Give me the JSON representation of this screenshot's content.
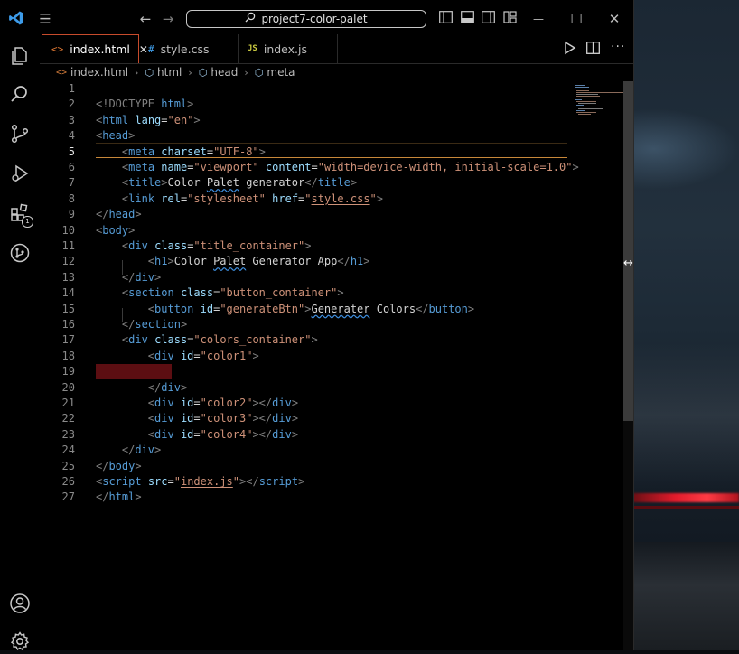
{
  "window": {
    "search_title": "project7-color-palet"
  },
  "tabs": [
    {
      "icon": "<>",
      "label": "index.html",
      "close": "✕"
    },
    {
      "icon": "#",
      "label": "style.css"
    },
    {
      "icon": "JS",
      "label": "index.js"
    }
  ],
  "breadcrumbs": [
    "index.html",
    "html",
    "head",
    "meta"
  ],
  "editor": {
    "current_line": 5,
    "line_numbers": [
      "1",
      "2",
      "3",
      "4",
      "5",
      "6",
      "7",
      "8",
      "9",
      "10",
      "11",
      "12",
      "13",
      "14",
      "15",
      "16",
      "17",
      "18",
      "19",
      "20",
      "21",
      "22",
      "23",
      "24",
      "25",
      "26",
      "27"
    ]
  },
  "code": {
    "l2_doctype": "DOCTYPE",
    "l2_html": "html",
    "l3_tag": "html",
    "l3_attr": "lang",
    "l3_val": "\"en\"",
    "l4_tag": "head",
    "l5_tag": "meta",
    "l5_attr": "charset",
    "l5_val": "\"UTF-8\"",
    "l6_tag": "meta",
    "l6_attr1": "name",
    "l6_val1": "\"viewport\"",
    "l6_attr2": "content",
    "l6_val2": "\"width=device-width, initial-scale=1.0\"",
    "l7_tag": "title",
    "l7_text_a": "Color ",
    "l7_text_b": "Palet",
    "l7_text_c": " generator",
    "l8_tag": "link",
    "l8_attr1": "rel",
    "l8_val1": "\"stylesheet\"",
    "l8_attr2": "href",
    "l8_val2a": "\"",
    "l8_val2b": "style.css",
    "l8_val2c": "\"",
    "l9_tag": "head",
    "l10_tag": "body",
    "l11_tag": "div",
    "l11_attr": "class",
    "l11_val": "\"title_container\"",
    "l12_tag": "h1",
    "l12_text_a": "Color ",
    "l12_text_b": "Palet",
    "l12_text_c": " Generator App",
    "l13_tag": "div",
    "l14_tag": "section",
    "l14_attr": "class",
    "l14_val": "\"button_container\"",
    "l15_tag": "button",
    "l15_attr": "id",
    "l15_val": "\"generateBtn\"",
    "l15_text_a": "Generater",
    "l15_text_b": " Colors",
    "l16_tag": "section",
    "l17_tag": "div",
    "l17_attr": "class",
    "l17_val": "\"colors_container\"",
    "l18_tag": "div",
    "l18_attr": "id",
    "l18_val": "\"color1\"",
    "l20_tag": "div",
    "l21_tag": "div",
    "l21_attr": "id",
    "l21_val": "\"color2\"",
    "l22_tag": "div",
    "l22_attr": "id",
    "l22_val": "\"color3\"",
    "l23_tag": "div",
    "l23_attr": "id",
    "l23_val": "\"color4\"",
    "l24_tag": "div",
    "l25_tag": "body",
    "l26_tag": "script",
    "l26_attr": "src",
    "l26_val_a": "\"",
    "l26_val_b": "index.js",
    "l26_val_c": "\"",
    "l27_tag": "html"
  },
  "icons": {
    "menu": "☰",
    "back": "←",
    "forward": "→",
    "search": "⌕",
    "minimize": "—",
    "maximize": "☐",
    "close": "✕",
    "more": "···"
  },
  "activity": {
    "extensions_badge": "1"
  },
  "colors": {
    "accent_tab": "#c74b2c",
    "error_block": "#5c0e12",
    "current_line": "#c8883a"
  }
}
